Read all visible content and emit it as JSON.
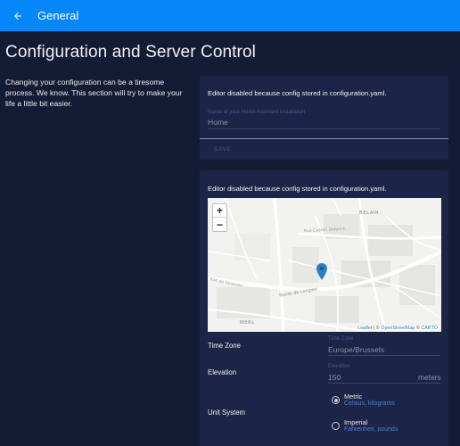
{
  "toolbar": {
    "title": "General"
  },
  "page": {
    "title": "Configuration and Server Control",
    "intro": "Changing your configuration can be a tiresome process. We know. This section will try to make your life a little bit easier."
  },
  "core_card": {
    "notice": "Editor disabled because config stored in configuration.yaml.",
    "name_label": "Name of your Home Assistant installation",
    "name_value": "Home",
    "save_label": "SAVE"
  },
  "location_card": {
    "notice": "Editor disabled because config stored in configuration.yaml.",
    "map": {
      "zoom_in": "+",
      "zoom_out": "−",
      "place_labels": [
        "BELAIR",
        "MERL",
        "Rue Caston Diderich",
        "Route de Longwy",
        "Rue de Strassen"
      ],
      "attribution": {
        "leaflet": "Leaflet",
        "sep1": " | © ",
        "osm": "OpenStreetMap",
        "sep2": " © ",
        "carto": "CARTO"
      }
    },
    "time_zone": {
      "label": "Time Zone",
      "field_label": "Time Zone",
      "value": "Europe/Brussels"
    },
    "elevation": {
      "label": "Elevation",
      "field_label": "Elevation",
      "value": "150",
      "suffix": "meters"
    },
    "unit_system": {
      "label": "Unit System",
      "options": [
        {
          "title": "Metric",
          "subtitle": "Celsius, kilograms",
          "checked": true
        },
        {
          "title": "Imperial",
          "subtitle": "Fahrenheit, pounds",
          "checked": false
        }
      ]
    }
  },
  "colors": {
    "toolbar": "#0587fa",
    "background": "#141b35",
    "card": "#1c2547",
    "marker": "#2f7fc4"
  }
}
